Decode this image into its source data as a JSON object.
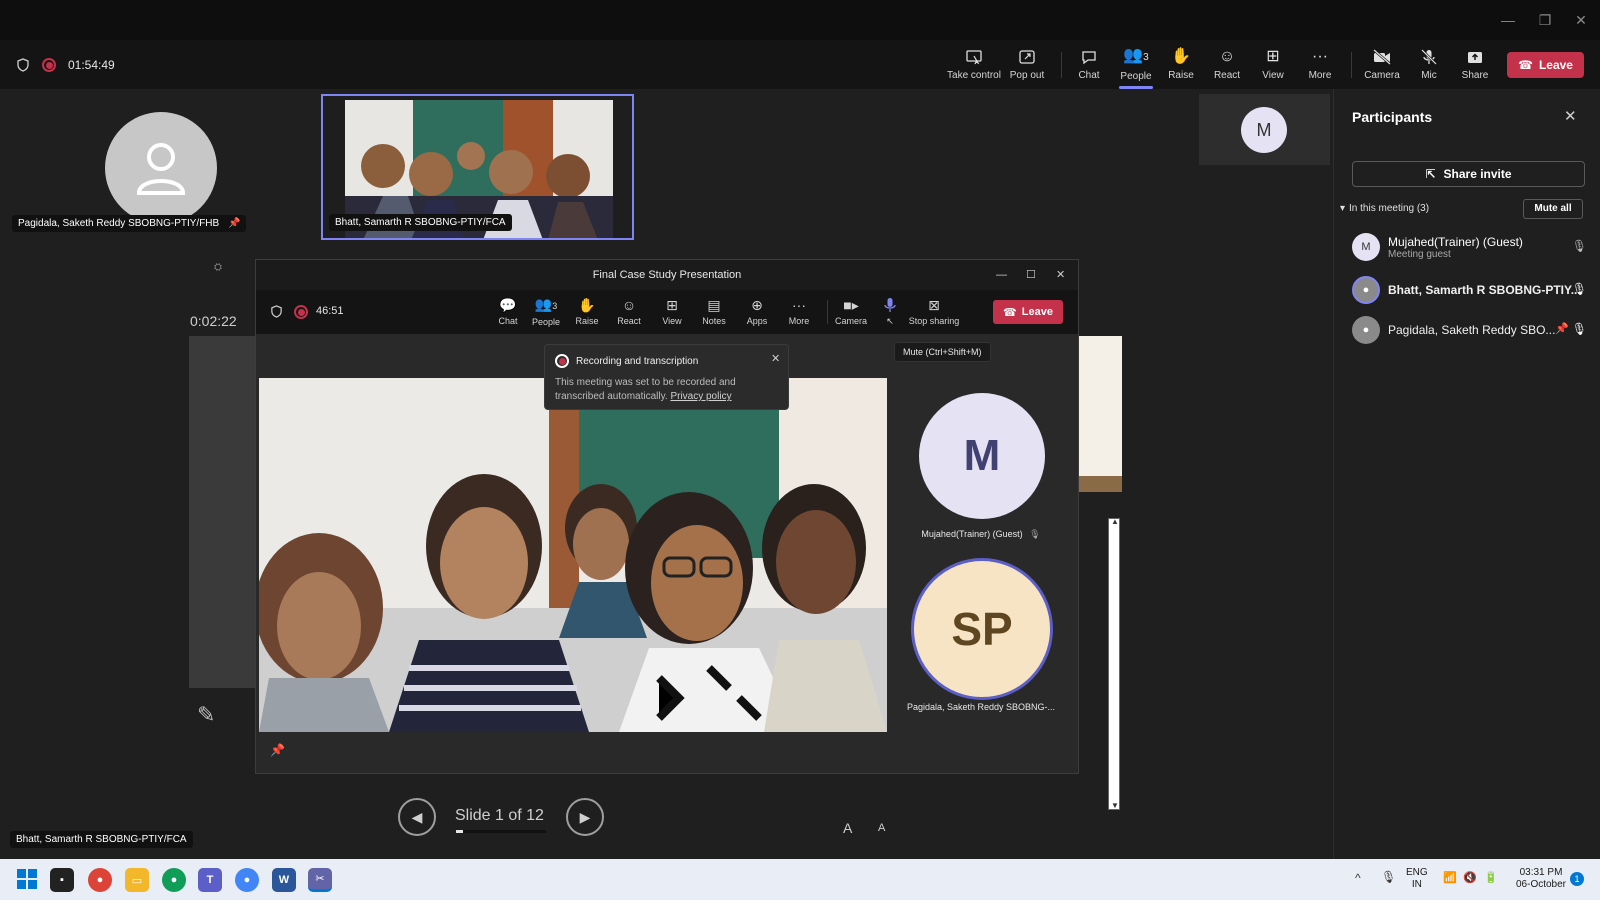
{
  "os": {
    "minimize_glyph": "—",
    "restore_glyph": "❐",
    "close_glyph": "✕"
  },
  "meeting": {
    "timer": "01:54:49",
    "toolbar": {
      "take_control": "Take control",
      "pop_out": "Pop out",
      "chat": "Chat",
      "people": "People",
      "people_count": "3",
      "raise": "Raise",
      "react": "React",
      "view": "View",
      "more": "More",
      "camera": "Camera",
      "mic": "Mic",
      "share": "Share",
      "leave": "Leave"
    }
  },
  "stage": {
    "avatar_name": "Pagidala, Saketh Reddy SBOBNG-PTIY/FHB",
    "thumb_name": "Bhatt, Samarth R SBOBNG-PTIY/FCA",
    "mini_avatar_initial": "M",
    "slide_timer": "0:02:22",
    "bottom_name": "Bhatt, Samarth R SBOBNG-PTIY/FCA",
    "slide_label": "Slide 1 of 12",
    "slide_progress": 0.08,
    "font_up": "A",
    "font_down": "A"
  },
  "popout": {
    "title": "Final Case Study Presentation",
    "timer": "46:51",
    "tools": {
      "chat": "Chat",
      "people": "People",
      "people_count": "3",
      "raise": "Raise",
      "react": "React",
      "view": "View",
      "notes": "Notes",
      "apps": "Apps",
      "more": "More",
      "camera": "Camera",
      "stop_sharing": "Stop sharing",
      "leave": "Leave"
    },
    "toast": {
      "title": "Recording and transcription",
      "body": "This meeting was set to be recorded and transcribed automatically.",
      "link": "Privacy policy"
    },
    "tooltip": "Mute (Ctrl+Shift+M)",
    "tiles": [
      {
        "initials": "M",
        "name": "Mujahed(Trainer) (Guest)"
      },
      {
        "initials": "SP",
        "name": "Pagidala, Saketh Reddy SBOBNG-..."
      }
    ]
  },
  "panel": {
    "title": "Participants",
    "share_invite": "Share invite",
    "section": "In this meeting (3)",
    "mute_all": "Mute all",
    "participants": [
      {
        "initial": "M",
        "name": "Mujahed(Trainer) (Guest)",
        "sub": "Meeting guest"
      },
      {
        "initial": "",
        "name": "Bhatt, Samarth R SBOBNG-PTIY...",
        "sub": ""
      },
      {
        "initial": "",
        "name": "Pagidala, Saketh Reddy SBO...",
        "sub": ""
      }
    ]
  },
  "taskbar": {
    "lang_top": "ENG",
    "lang_bottom": "IN",
    "time": "03:31 PM",
    "date": "06-October",
    "notification_count": "1",
    "apps": [
      "W"
    ]
  },
  "colors": {
    "accent": "#7f85f5",
    "danger": "#c4314b",
    "sp_avatar": "#f7e4c4",
    "m_avatar": "#e4e2f3"
  }
}
